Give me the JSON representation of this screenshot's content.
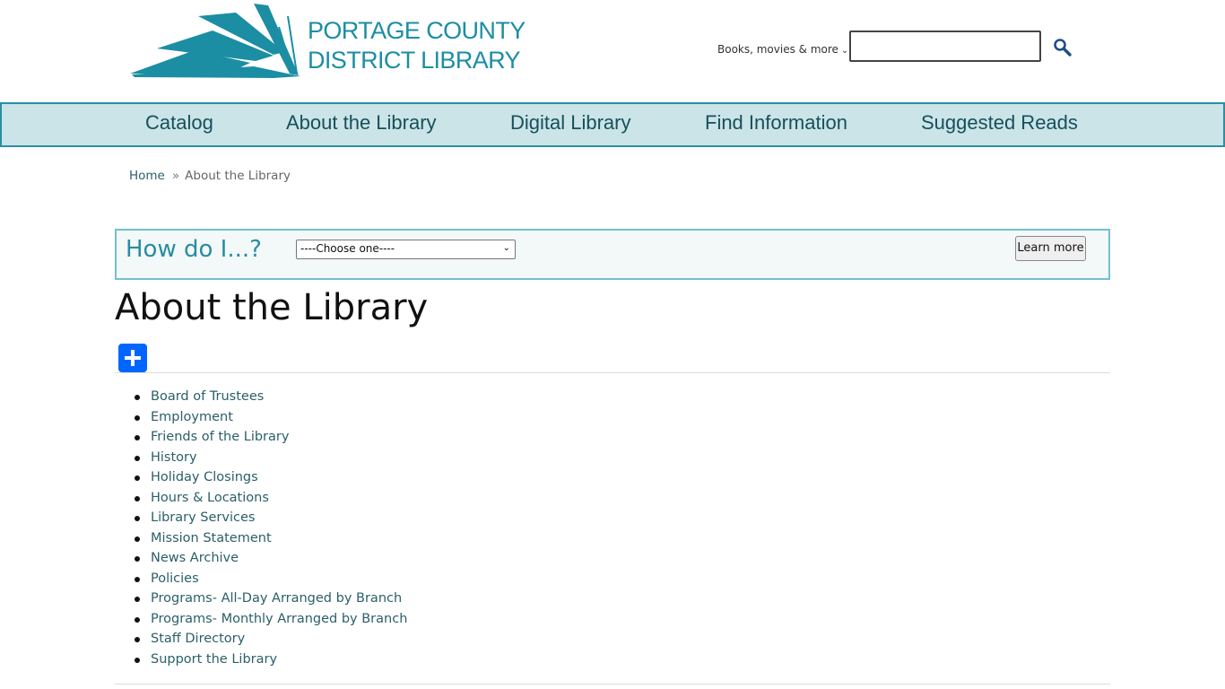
{
  "logo": {
    "line1": "PORTAGE COUNTY",
    "line2": "DISTRICT LIBRARY"
  },
  "search": {
    "scope_label": "Books, movies & more",
    "input_value": "",
    "button_icon": "search-icon"
  },
  "nav": {
    "items": [
      {
        "label": "Catalog"
      },
      {
        "label": "About the Library"
      },
      {
        "label": "Digital Library"
      },
      {
        "label": "Find Information"
      },
      {
        "label": "Suggested Reads"
      }
    ]
  },
  "breadcrumb": {
    "home": "Home",
    "separator": "»",
    "current": "About the Library"
  },
  "howdoi": {
    "label": "How do I...?",
    "select_value": "----Choose one----",
    "button_label": "Learn more"
  },
  "page": {
    "title": "About the Library",
    "share_icon": "plus-icon"
  },
  "links": [
    "Board of Trustees",
    "Employment",
    "Friends of the Library",
    "History",
    "Holiday Closings",
    "Hours & Locations",
    "Library Services",
    "Mission Statement",
    "News Archive",
    "Policies",
    "Programs- All-Day Arranged by Branch",
    "Programs- Monthly Arranged by Branch",
    "Staff Directory",
    "Support the Library"
  ],
  "colors": {
    "brand_teal": "#1b8ea3",
    "nav_background": "#cbe4e7",
    "nav_border": "#2b8fa3",
    "link": "#2b5f69",
    "share_blue": "#0166ff"
  }
}
